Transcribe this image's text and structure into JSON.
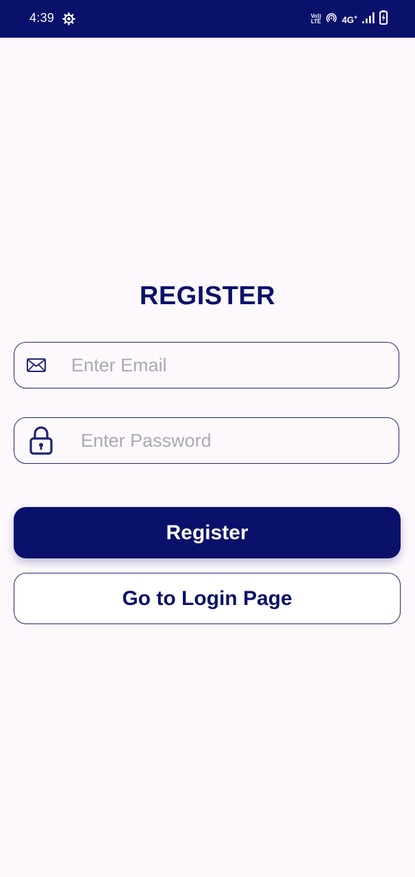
{
  "status_bar": {
    "time": "4:39",
    "volte_top": "Vo))",
    "volte_bottom": "LTE",
    "network": "4G",
    "network_sup": "+",
    "icons": [
      "settings-gear-icon",
      "hotspot-icon",
      "signal-icon",
      "battery-charging-icon"
    ]
  },
  "register": {
    "title": "REGISTER",
    "email_placeholder": "Enter Email",
    "email_value": "",
    "password_placeholder": "Enter Password",
    "password_value": "",
    "register_button": "Register",
    "login_button": "Go to Login Page"
  },
  "colors": {
    "primary": "#0a116b",
    "background": "#fdf8fc",
    "placeholder": "#a9a9b4"
  }
}
